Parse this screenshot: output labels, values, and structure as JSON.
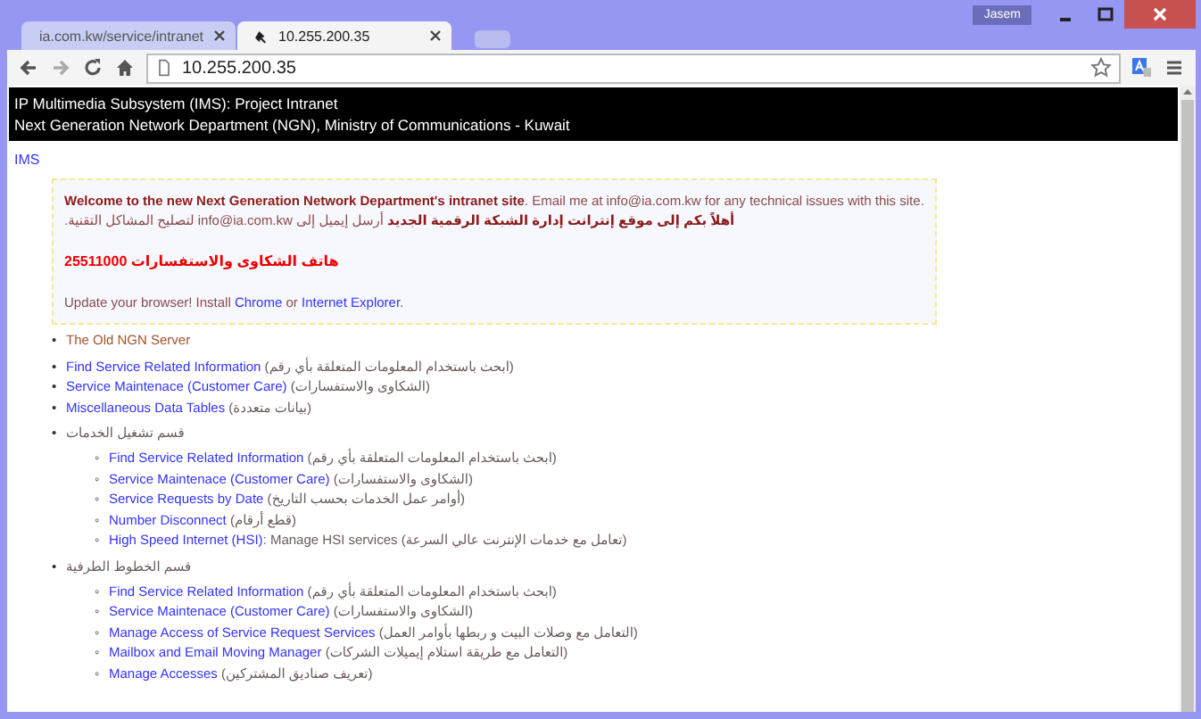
{
  "window": {
    "user": "Jasem"
  },
  "tabs": {
    "first": {
      "title": "ia.com.kw/service/intranet",
      "selected": false
    },
    "second": {
      "title": "10.255.200.35",
      "selected": true
    }
  },
  "address": "10.255.200.35",
  "header": [
    "IP Multimedia Subsystem (IMS): Project Intranet",
    "Next Generation Network Department (NGN), Ministry of Communications - Kuwait"
  ],
  "breadcrumb": "IMS",
  "notice": {
    "welcome": "**Welcome to the new Next Generation Network Department's intranet site**. Email me at info@ia.com.kw for any technical issues with this site.",
    "welcome_ar": "**أهلاً بكم إلى موقع إنترانت إدارة الشبكة الرقمية الجديد** أرسل إيميل إلى info@ia.com.kw لتصليح المشاكل التقنية.",
    "phone": "هاتف الشكاوى والاستفسارات 25511000",
    "update": {
      "text": "Update your browser! Install ",
      "link_1": "Chrome",
      "joiner": " or ",
      "link_2": "Internet Explorer",
      "end": "."
    }
  },
  "lists": [
    [
      {
        "kind": "visited",
        "bullet": "•",
        "link": "The Old NGN Server"
      }
    ],
    [
      {
        "kind": "link",
        "bullet": "•",
        "link": "Find Service Related Information",
        "note": " (ابحث باستخدام المعلومات المتعلقة بأي رقم)"
      },
      {
        "kind": "link",
        "bullet": "•",
        "link": "Service Maintenace (Customer Care)",
        "note": " (الشكاوى والاستفسارات)"
      },
      {
        "kind": "link",
        "bullet": "•",
        "link": "Miscellaneous Data Tables",
        "note": " (بيانات متعددة)"
      }
    ],
    [
      {
        "kind": "group",
        "bullet": "•",
        "title": "قسم تشغيل الخدمات",
        "children": [
          {
            "kind": "link",
            "bullet": "◦",
            "link": "Find Service Related Information",
            "note": " (ابحث باستخدام المعلومات المتعلقة بأي رقم)"
          },
          {
            "kind": "link",
            "bullet": "◦",
            "link": "Service Maintenace (Customer Care)",
            "note": " (الشكاوى والاستفسارات)"
          },
          {
            "kind": "link",
            "bullet": "◦",
            "link": "Service Requests by Date",
            "note": " (أوامر عمل الخدمات بحسب التاريخ)"
          },
          {
            "kind": "link",
            "bullet": "◦",
            "link": "Number Disconnect",
            "note": " (قطع أرقام)"
          },
          {
            "kind": "link",
            "bullet": "◦",
            "link": "High Speed Internet (HSI)",
            "note": ": Manage HSI services (تعامل مع خدمات الإنترنت عالي السرعة)"
          }
        ]
      }
    ],
    [
      {
        "kind": "group",
        "bullet": "•",
        "title": "قسم الخطوط الطرفية",
        "children": [
          {
            "kind": "link",
            "bullet": "◦",
            "link": "Find Service Related Information",
            "note": " (ابحث باستخدام المعلومات المتعلقة بأي رقم)"
          },
          {
            "kind": "link",
            "bullet": "◦",
            "link": "Service Maintenace (Customer Care)",
            "note": " (الشكاوى والاستفسارات)"
          },
          {
            "kind": "link",
            "bullet": "◦",
            "link": "Manage Access of Service Request Services",
            "note": " (التعامل مع وصلات البيت و ربطها بأوامر العمل)"
          },
          {
            "kind": "link",
            "bullet": "◦",
            "link": "Mailbox and Email Moving Manager",
            "note": " (التعامل مع طريقة استلام إيميلات الشركات)"
          },
          {
            "kind": "link",
            "bullet": "◦",
            "link": "Manage Accesses",
            "note": " (تعريف صناديق المشتركين)"
          }
        ]
      }
    ]
  ]
}
